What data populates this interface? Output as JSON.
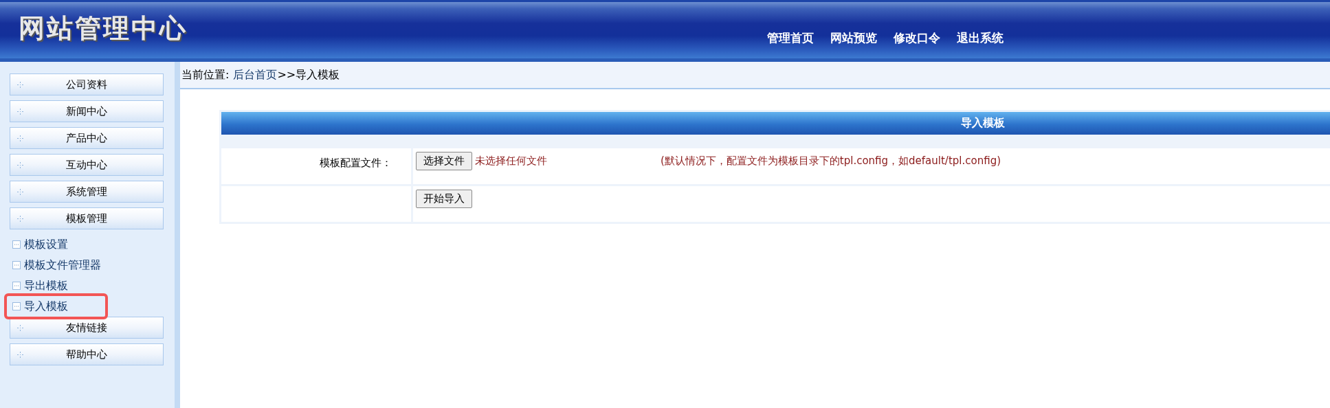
{
  "header": {
    "title": "网站管理中心",
    "nav": [
      "管理首页",
      "网站预览",
      "修改口令",
      "退出系统"
    ]
  },
  "sidebar": {
    "groups": [
      {
        "label": "公司资料"
      },
      {
        "label": "新闻中心"
      },
      {
        "label": "产品中心"
      },
      {
        "label": "互动中心"
      },
      {
        "label": "系统管理"
      },
      {
        "label": "模板管理",
        "children": [
          {
            "label": "模板设置",
            "selected": false
          },
          {
            "label": "模板文件管理器",
            "selected": false
          },
          {
            "label": "导出模板",
            "selected": false
          },
          {
            "label": "导入模板",
            "selected": true
          }
        ]
      },
      {
        "label": "友情链接"
      },
      {
        "label": "帮助中心"
      }
    ]
  },
  "breadcrumb": {
    "prefix": "当前位置:",
    "link": "后台首页",
    "trail": ">>导入模板"
  },
  "panel": {
    "title": "导入模板",
    "rows": [
      {
        "kind": "file",
        "label": "模板配置文件：",
        "button": "选择文件",
        "status": "未选择任何文件",
        "hint": "(默认情况下，配置文件为模板目录下的tpl.config，如default/tpl.config)"
      },
      {
        "kind": "submit",
        "button": "开始导入"
      }
    ]
  }
}
